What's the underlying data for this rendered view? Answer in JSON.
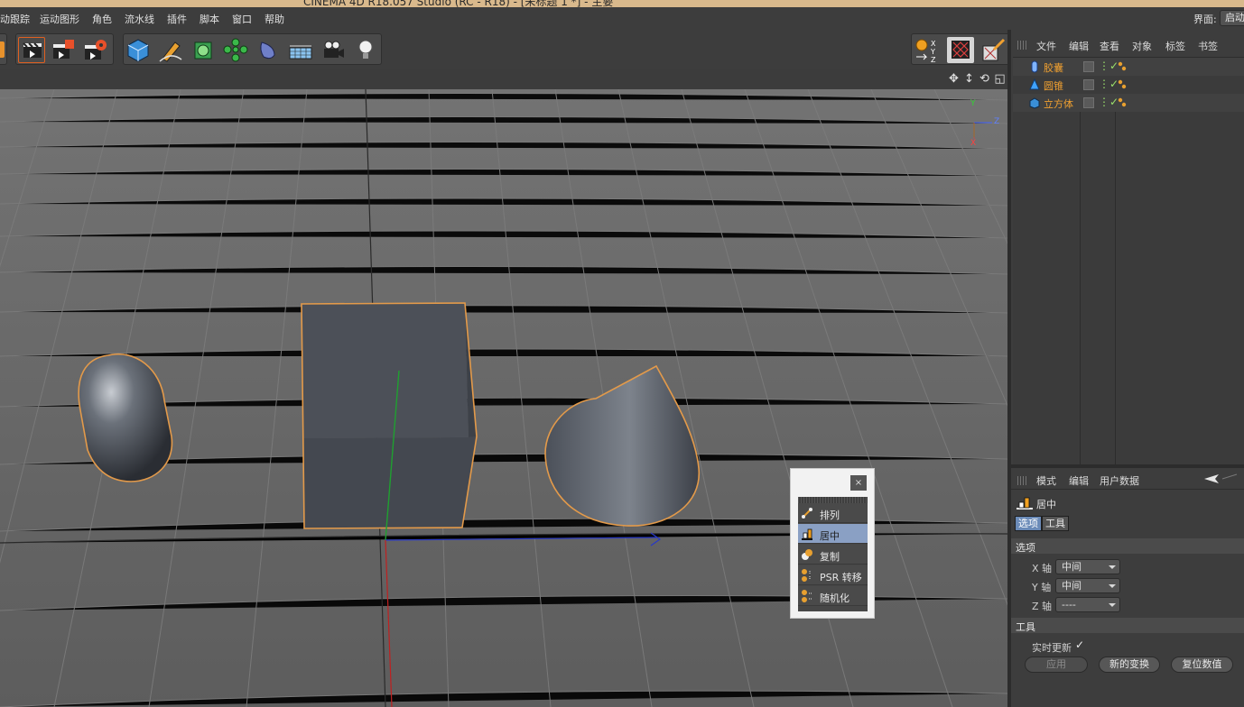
{
  "window_title": "CINEMA 4D R18.057 Studio (RC - R18) - [未标题 1 *] - 主要",
  "menubar": {
    "items": [
      "动跟踪",
      "运动图形",
      "角色",
      "流水线",
      "插件",
      "脚本",
      "窗口",
      "帮助"
    ],
    "layout_label": "界面:",
    "layout_value": "启动"
  },
  "toolbar": {
    "icons": [
      "render-view-icon",
      "render-picture-queue-icon",
      "render-settings-icon",
      "cube-primitive-icon",
      "pen-spline-icon",
      "subdivision-icon",
      "array-cloner-icon",
      "deformer-icon",
      "floor-environment-icon",
      "camera-icon",
      "light-icon",
      "coordinate-system-icon",
      "texture-checker-icon",
      "paint-brush-icon"
    ]
  },
  "viewport": {
    "header_icons": [
      "move-view-icon",
      "pan-view-icon",
      "rotate-view-icon",
      "maximize-view-icon"
    ],
    "axis_labels": {
      "y": "Y",
      "z": "Z",
      "x": "X"
    }
  },
  "palette": {
    "close": "×",
    "items": [
      {
        "label": "排列",
        "icon": "arrange-icon",
        "selected": false
      },
      {
        "label": "居中",
        "icon": "center-icon",
        "selected": true
      },
      {
        "label": "复制",
        "icon": "duplicate-icon",
        "selected": false
      },
      {
        "label": "PSR 转移",
        "icon": "psr-transfer-icon",
        "selected": false
      },
      {
        "label": "随机化",
        "icon": "randomize-icon",
        "selected": false
      }
    ]
  },
  "object_manager": {
    "menu": [
      "文件",
      "编辑",
      "查看",
      "对象",
      "标签",
      "书签"
    ],
    "objects": [
      {
        "name": "胶囊",
        "icon": "capsule-icon",
        "color": "#f0a030"
      },
      {
        "name": "圆锥",
        "icon": "cone-icon",
        "color": "#f0a030"
      },
      {
        "name": "立方体",
        "icon": "cube-icon",
        "color": "#f0a030"
      }
    ]
  },
  "attribute_manager": {
    "menu": [
      "模式",
      "编辑",
      "用户数据"
    ],
    "title": "居中",
    "tabs": {
      "options": "选项",
      "tool": "工具"
    },
    "section_options": "选项",
    "fields": [
      {
        "label": "X 轴",
        "value": "中间"
      },
      {
        "label": "Y 轴",
        "value": "中间"
      },
      {
        "label": "Z 轴",
        "value": "----"
      }
    ],
    "section_tool": "工具",
    "realtime_label": "实时更新",
    "realtime_checked": "✓",
    "buttons": {
      "apply": "应用",
      "new_transform": "新的变换",
      "reset_values": "复位数值"
    }
  },
  "colors": {
    "accent_orange": "#f0a030",
    "selection_blue": "#8aa0c4",
    "tab_blue": "#6b8bb8"
  }
}
